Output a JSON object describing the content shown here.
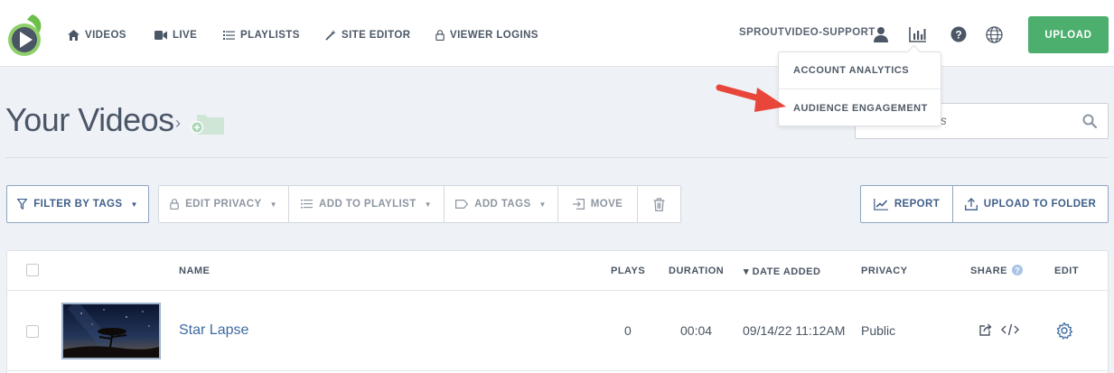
{
  "nav": {
    "items": [
      {
        "label": "VIDEOS",
        "icon": "home-icon"
      },
      {
        "label": "LIVE",
        "icon": "video-camera-icon"
      },
      {
        "label": "PLAYLISTS",
        "icon": "list-icon"
      },
      {
        "label": "SITE EDITOR",
        "icon": "magic-wand-icon"
      },
      {
        "label": "VIEWER LOGINS",
        "icon": "lock-icon"
      }
    ],
    "account": "SPROUTVIDEO-SUPPORT",
    "upload_label": "UPLOAD"
  },
  "analytics_menu": {
    "items": [
      "ACCOUNT ANALYTICS",
      "AUDIENCE ENGAGEMENT"
    ]
  },
  "page": {
    "title": "Your Videos",
    "search_placeholder": "Search Videos"
  },
  "toolbar": {
    "filter_label": "FILTER BY TAGS",
    "edit_privacy_label": "EDIT PRIVACY",
    "add_playlist_label": "ADD TO PLAYLIST",
    "add_tags_label": "ADD TAGS",
    "move_label": "MOVE",
    "report_label": "REPORT",
    "upload_folder_label": "UPLOAD TO FOLDER"
  },
  "table": {
    "headers": {
      "name": "NAME",
      "plays": "PLAYS",
      "duration": "DURATION",
      "date_added": "▾ DATE ADDED",
      "privacy": "PRIVACY",
      "share": "SHARE",
      "edit": "EDIT"
    },
    "rows": [
      {
        "name": "Star Lapse",
        "plays": "0",
        "duration": "00:04",
        "date_added": "09/14/22 11:12AM",
        "privacy": "Public"
      }
    ]
  },
  "colors": {
    "accent_green": "#4caf6e",
    "link_blue": "#3e6aa0",
    "arrow_red": "#e8463a"
  }
}
